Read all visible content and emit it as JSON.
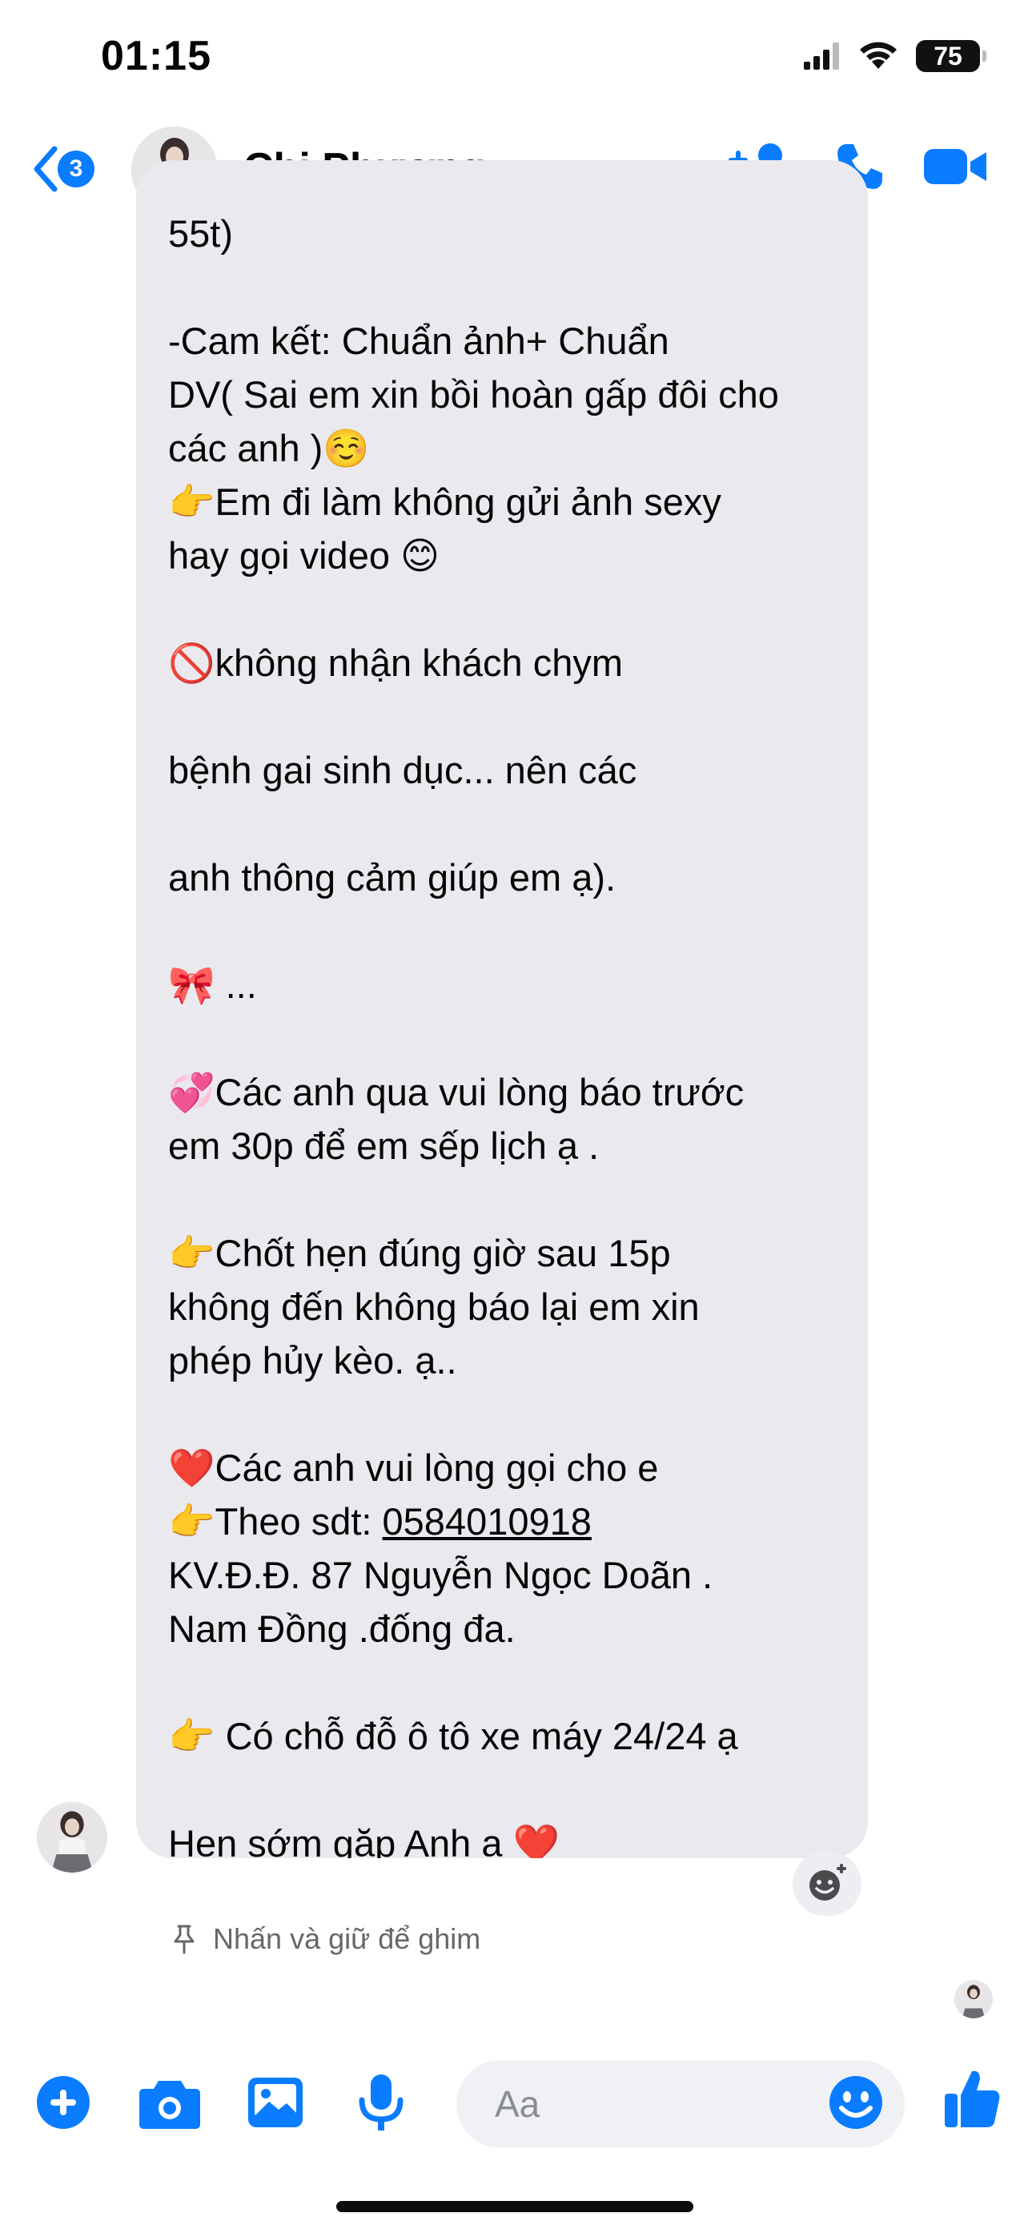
{
  "status": {
    "time": "01:15",
    "battery": "75"
  },
  "header": {
    "back_badge": "3",
    "contact_name": "Chi Phương"
  },
  "message": {
    "lines": [
      "55t)",
      "",
      "-Cam kết: Chuẩn ảnh+ Chuẩn",
      "DV( Sai em xin bồi hoàn gấp đôi cho",
      "các anh )☺️",
      "👉Em đi làm không gửi ảnh sexy",
      "hay gọi video 😊",
      "",
      "🚫không nhận khách chym",
      "",
      "bệnh gai sinh dục... nên các",
      "",
      "anh thông cảm giúp em ạ).",
      "",
      "🎀 ...",
      "",
      "💞Các anh qua vui lòng báo trước",
      "em 30p để em sếp lịch ạ .",
      "",
      "👉Chốt hẹn đúng giờ sau 15p",
      "không đến không báo lại em xin",
      "phép hủy kèo. ạ..",
      "",
      "❤️Các anh vui lòng gọi cho e"
    ],
    "phone_prefix": "👉Theo sdt: ",
    "phone": "0584010918",
    "lines_after": [
      "KV.Đ.Đ. 87 Nguyễn Ngọc Doãn .",
      "Nam Đồng .đống đa.",
      "",
      "👉 Có chỗ đỗ ô tô xe máy 24/24 ạ",
      "",
      "Hẹn sớm gặp Anh ạ ❤️"
    ]
  },
  "pin_hint": "Nhấn và giữ để ghim",
  "composer": {
    "placeholder": "Aa"
  },
  "colors": {
    "accent": "#0a7cff",
    "bubble": "#e9e9ee",
    "hint": "#65676b"
  },
  "icons": [
    "back-chevron-icon",
    "add-person-icon",
    "phone-icon",
    "video-icon",
    "react-icon",
    "pin-icon",
    "plus-icon",
    "camera-icon",
    "image-icon",
    "mic-icon",
    "emoji-icon",
    "thumbs-up-icon"
  ]
}
